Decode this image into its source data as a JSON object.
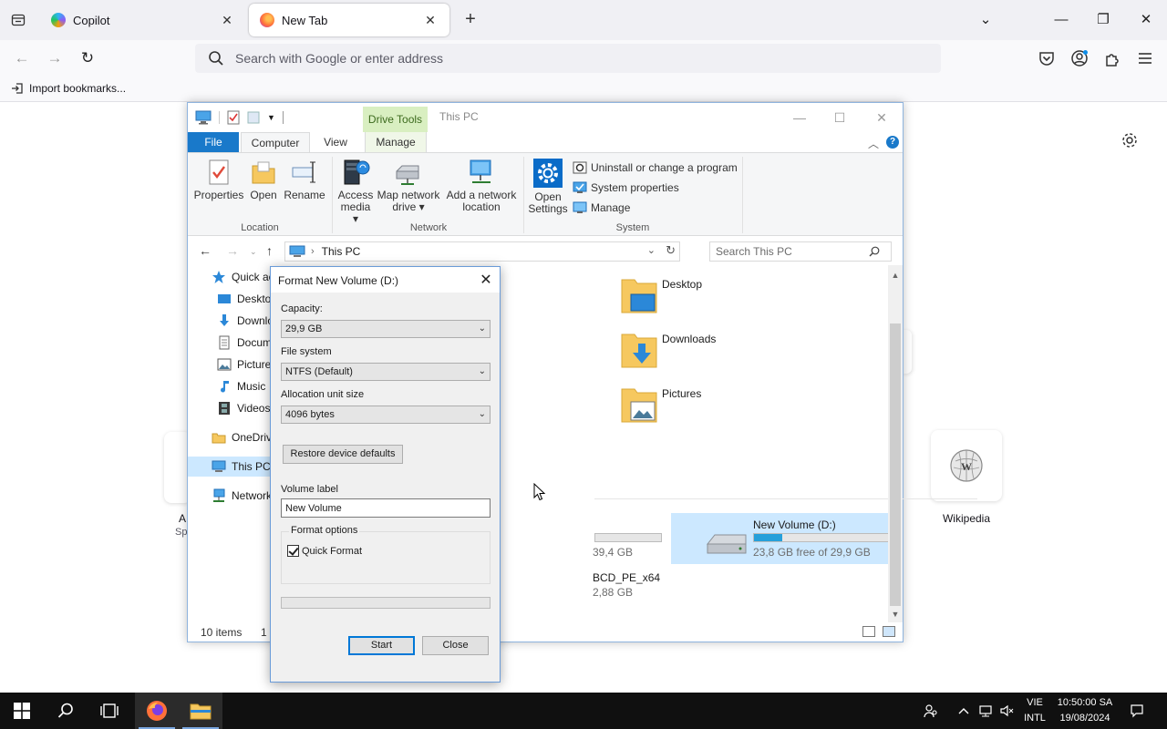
{
  "browser": {
    "tabs": [
      {
        "title": "Copilot",
        "active": false
      },
      {
        "title": "New Tab",
        "active": true
      }
    ],
    "address_placeholder": "Search with Google or enter address",
    "bookmarks_import": "Import bookmarks...",
    "newtab": {
      "left_tile_label": "A",
      "left_tile_sub": "Sp",
      "wiki_label": "Wikipedia"
    }
  },
  "explorer": {
    "contextual_tab": "Drive Tools",
    "window_title": "This PC",
    "ribbon_tabs": {
      "file": "File",
      "computer": "Computer",
      "view": "View",
      "manage": "Manage"
    },
    "ribbon": {
      "location": {
        "label": "Location",
        "properties": "Properties",
        "open": "Open",
        "rename": "Rename"
      },
      "network": {
        "label": "Network",
        "access_media_1": "Access",
        "access_media_2": "media ▾",
        "map_drive_1": "Map network",
        "map_drive_2": "drive ▾",
        "add_location_1": "Add a network",
        "add_location_2": "location"
      },
      "system": {
        "label": "System",
        "open_settings_1": "Open",
        "open_settings_2": "Settings",
        "uninstall": "Uninstall or change a program",
        "sys_props": "System properties",
        "manage": "Manage"
      }
    },
    "address": {
      "path": "This PC",
      "search_placeholder": "Search This PC"
    },
    "nav": [
      {
        "label": "Quick ac"
      },
      {
        "label": "Deskto"
      },
      {
        "label": "Downlo"
      },
      {
        "label": "Docum"
      },
      {
        "label": "Picture"
      },
      {
        "label": "Music"
      },
      {
        "label": "Videos"
      },
      {
        "label": "OneDrive"
      },
      {
        "label": "This PC"
      },
      {
        "label": "Network"
      }
    ],
    "folders": [
      {
        "name": "Desktop"
      },
      {
        "name": "Downloads"
      },
      {
        "name": "Pictures"
      }
    ],
    "drives": {
      "partial_size": "39,4 GB",
      "new_volume": {
        "name": "New Volume (D:)",
        "free": "23,8 GB free of 29,9 GB",
        "used_fraction": 0.204
      },
      "pe": {
        "name": "BCD_PE_x64",
        "size": "2,88 GB"
      }
    },
    "status": {
      "items": "10 items",
      "selected": "1 i"
    }
  },
  "format_dialog": {
    "title": "Format New Volume (D:)",
    "capacity_label": "Capacity:",
    "capacity_value": "29,9 GB",
    "fs_label": "File system",
    "fs_value": "NTFS (Default)",
    "alloc_label": "Allocation unit size",
    "alloc_value": "4096 bytes",
    "restore_btn": "Restore device defaults",
    "volume_label": "Volume label",
    "volume_value": "New Volume",
    "options_legend": "Format options",
    "quick_format": "Quick Format",
    "quick_format_checked": true,
    "start_btn": "Start",
    "close_btn": "Close"
  },
  "taskbar": {
    "lang_top": "VIE",
    "lang_bottom": "INTL",
    "time": "10:50:00 SA",
    "date": "19/08/2024"
  },
  "colors": {
    "accent": "#1979ca",
    "selection": "#cce8ff",
    "drive_tools": "#d9efc1",
    "drive_bar": "#26a0da"
  }
}
